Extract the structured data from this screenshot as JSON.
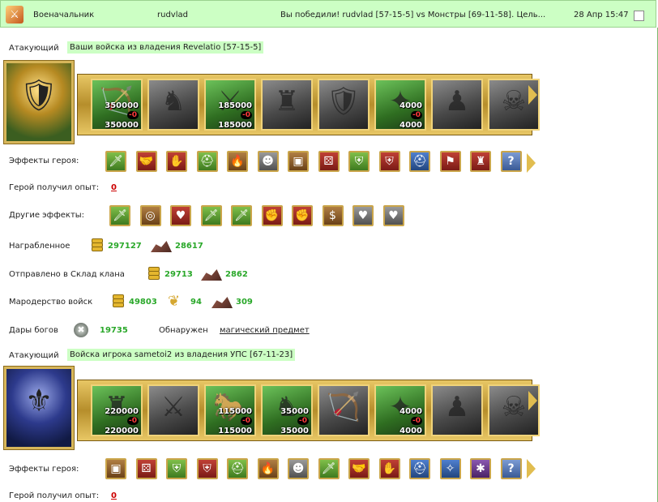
{
  "header": {
    "title": "Военачальник",
    "player": "rudvlad",
    "message": "Вы победили! rudvlad [57-15-5] vs Монстры [69-11-58]. Цель...",
    "datetime": "28 Апр 15:47"
  },
  "battle1": {
    "role": "Атакующий",
    "title": "Ваши войска из владения Revelatio [57-15-5]",
    "hero_effects_label": "Эффекты героя:",
    "exp_label": "Герой получил опыт:",
    "exp_value": "0",
    "other_effects_label": "Другие эффекты:",
    "looted_label": "Награбленное",
    "looted_gold": "297127",
    "looted_ore": "28617",
    "sent_label": "Отправлено в Склад клана",
    "sent_gold": "29713",
    "sent_ore": "2862",
    "marauding_label": "Мародерство войск",
    "marauding_gold": "49803",
    "marauding_grain": "94",
    "marauding_ore": "309",
    "gods_label": "Дары богов",
    "gods_value": "19735",
    "found_label": "Обнаружен",
    "found_link": "магический предмет",
    "units": [
      {
        "a": "350000",
        "b": "0",
        "c": "350000",
        "color": true
      },
      {
        "a": "",
        "b": "",
        "c": "",
        "color": false
      },
      {
        "a": "185000",
        "b": "0",
        "c": "185000",
        "color": true
      },
      {
        "a": "",
        "b": "",
        "c": "",
        "color": false
      },
      {
        "a": "",
        "b": "",
        "c": "",
        "color": false
      },
      {
        "a": "4000",
        "b": "0",
        "c": "4000",
        "color": true
      },
      {
        "a": "",
        "b": "",
        "c": "",
        "color": false
      },
      {
        "a": "",
        "b": "",
        "c": "",
        "color": false
      }
    ]
  },
  "battle2": {
    "role": "Атакующий",
    "title": "Войска игрока sametoi2 из владения УПС [67-11-23]",
    "hero_effects_label": "Эффекты героя:",
    "exp_label": "Герой получил опыт:",
    "exp_value": "0",
    "units": [
      {
        "a": "220000",
        "b": "0",
        "c": "220000",
        "color": true
      },
      {
        "a": "",
        "b": "",
        "c": "",
        "color": false
      },
      {
        "a": "115000",
        "b": "0",
        "c": "115000",
        "color": true
      },
      {
        "a": "35000",
        "b": "0",
        "c": "35000",
        "color": true
      },
      {
        "a": "",
        "b": "",
        "c": "",
        "color": false
      },
      {
        "a": "4000",
        "b": "0",
        "c": "4000",
        "color": true
      },
      {
        "a": "",
        "b": "",
        "c": "",
        "color": false
      },
      {
        "a": "",
        "b": "",
        "c": "",
        "color": false
      }
    ]
  },
  "icons": {
    "hero_effects_1": [
      "sword-icon",
      "handshake-icon",
      "hand-icon",
      "helmet-icon",
      "fire-icon",
      "mask-icon",
      "chest-icon",
      "dice-icon",
      "shield-icon",
      "handshake-shield-icon",
      "knight-helmet-icon",
      "banner-icon",
      "armor-icon",
      "question-icon"
    ],
    "other_effects": [
      "sword-icon",
      "ring-icon",
      "heart-sword-icon",
      "sword-icon",
      "sword-icon",
      "sword-fist-icon",
      "fist-icon",
      "coin-bag-icon",
      "heart-icon",
      "heart-icon"
    ],
    "hero_effects_2": [
      "chest-icon",
      "dice-icon",
      "shield-icon",
      "handshake-shield-icon",
      "helmet-icon",
      "fire-icon",
      "mask-icon",
      "sword-icon",
      "handshake-icon",
      "hand-icon",
      "knight-helmet-icon",
      "amulet-icon",
      "spider-icon",
      "question-icon"
    ]
  },
  "colors": {
    "highlight": "#ccffc4",
    "gold_frame": "#d7b65a",
    "green_value": "#2aa82a",
    "red_link": "#cc0000"
  }
}
